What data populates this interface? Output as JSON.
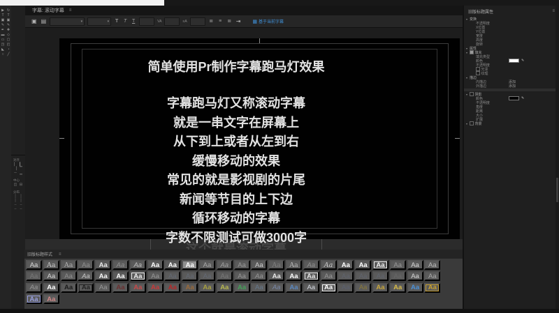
{
  "tab": {
    "title": "字幕: 滚动字幕",
    "menu": "≡"
  },
  "toolbar": {
    "new_title_glyph": "▣",
    "templates_glyph": "▤",
    "font_family_arrow": "▾",
    "font_style_arrow": "▾",
    "bold_glyph": "T",
    "italic_glyph": "T",
    "underline_glyph": "T",
    "kerning_glyph": "VA",
    "leading_glyph": "≡A",
    "align_left_glyph": "≣",
    "align_center_glyph": "≡",
    "align_right_glyph": "≣",
    "tab_stops_glyph": "⇥",
    "based_on_current": {
      "glyph": "▦",
      "label": "基于当前字幕"
    }
  },
  "tools": [
    {
      "n": "selection-tool",
      "g": "▶"
    },
    {
      "n": "rotation-tool",
      "g": "↻"
    },
    {
      "n": "type-tool",
      "g": "T"
    },
    {
      "n": "vertical-type-tool",
      "g": "T"
    },
    {
      "n": "area-type-tool",
      "g": "▣"
    },
    {
      "n": "vertical-area-type-tool",
      "g": "▣"
    },
    {
      "n": "path-type-tool",
      "g": "✎"
    },
    {
      "n": "vertical-path-type-tool",
      "g": "✎"
    },
    {
      "n": "pen-tool",
      "g": "✒"
    },
    {
      "n": "add-anchor-point-tool",
      "g": "✚"
    },
    {
      "n": "delete-anchor-point-tool",
      "g": "▬"
    },
    {
      "n": "convert-anchor-point-tool",
      "g": "◇"
    },
    {
      "n": "rectangle-tool",
      "g": "▭"
    },
    {
      "n": "rounded-rectangle-tool",
      "g": "▢"
    },
    {
      "n": "clipped-corner-rectangle-tool",
      "g": "◳"
    },
    {
      "n": "round-rectangle-tool",
      "g": "◰"
    },
    {
      "n": "wedge-tool",
      "g": "◣"
    },
    {
      "n": "arc-tool",
      "g": "◔"
    },
    {
      "n": "ellipse-tool",
      "g": "○"
    },
    {
      "n": "line-tool",
      "g": "╱"
    }
  ],
  "align_panel": {
    "sections": [
      {
        "label": "对齐",
        "buttons": [
          {
            "n": "align-horiz-left-button",
            "g": "▏"
          },
          {
            "n": "align-horiz-center-button",
            "g": "▎"
          },
          {
            "n": "align-horiz-right-button",
            "g": "▕"
          },
          {
            "n": "align-vert-top-button",
            "g": "▔"
          },
          {
            "n": "align-vert-center-button",
            "g": "─"
          },
          {
            "n": "align-vert-bottom-button",
            "g": "▁"
          }
        ]
      },
      {
        "label": "中心",
        "buttons": [
          {
            "n": "center-horizontal-button",
            "g": "◫"
          },
          {
            "n": "center-vertical-button",
            "g": "⊟"
          }
        ]
      },
      {
        "label": "分布",
        "buttons": [
          {
            "n": "distribute-left-button",
            "g": "┆"
          },
          {
            "n": "distribute-horiz-center-button",
            "g": "┆"
          },
          {
            "n": "distribute-right-button",
            "g": "┆"
          },
          {
            "n": "distribute-horiz-space-button",
            "g": "┆"
          },
          {
            "n": "distribute-top-button",
            "g": "┄"
          },
          {
            "n": "distribute-vert-center-button",
            "g": "┄"
          },
          {
            "n": "distribute-bottom-button",
            "g": "┄"
          },
          {
            "n": "distribute-vert-space-button",
            "g": "┄"
          }
        ]
      }
    ]
  },
  "canvas": {
    "title": "简单使用Pr制作字幕跑马灯效果",
    "lines": [
      "字幕跑马灯又称滚动字幕",
      "就是一串文字在屏幕上",
      "从下到上或者从左到右",
      "缓慢移动的效果",
      "常见的就是影视剧的片尾",
      "新闻等节目的上下边",
      "循环移动的字幕",
      "字数不限测试可做3000字"
    ],
    "faded_line": "这个就是滚动字幕"
  },
  "styles_panel": {
    "header": "旧版标题样式",
    "menu": "≡",
    "sample": "Aa",
    "rows": [
      [
        {
          "c": "#d8d8d8"
        },
        {
          "c": "#c8c8c8",
          "serif": 1
        },
        {
          "c": "#b0b0b0",
          "serif": 1
        },
        {
          "c": "#909090"
        },
        {
          "c": "#e8e8e8",
          "b": 1
        },
        {
          "c": "#909090",
          "i": 1
        },
        {
          "c": "#c0c0c0",
          "i": 1
        },
        {
          "c": "#ffffff",
          "b": 1
        },
        {
          "c": "#ffffff",
          "b": 1
        },
        {
          "c": "#ffffff",
          "b": 1,
          "bg": "#8f8f8f"
        },
        {
          "c": "#a8a8a8"
        },
        {
          "c": "#a0a0a0",
          "i": 1
        },
        {
          "c": "#989898"
        },
        {
          "c": "#d0d0d0"
        },
        {
          "c": "#808080",
          "serif": 1
        },
        {
          "c": "#b8b8b8",
          "serif": 1
        },
        {
          "c": "#909090",
          "i": 1
        },
        {
          "c": "#c8c8c8",
          "i": 1,
          "serif": 1
        },
        {
          "c": "#ffffff",
          "b": 1
        },
        {
          "c": "#ffffff",
          "b": 1
        },
        {
          "c": "#f0f0f0",
          "b": 1,
          "box": 1
        },
        {
          "c": "#989898"
        },
        {
          "c": "#d8d8d8"
        },
        {
          "c": "#b8b8b8"
        }
      ],
      [
        {
          "c": "#787878"
        },
        {
          "c": "#d8d8d8"
        },
        {
          "c": "#909090"
        },
        {
          "c": "#c8c8c8",
          "i": 1
        },
        {
          "c": "#f8f8f8",
          "b": 1
        },
        {
          "c": "#ffffff",
          "b": 1
        },
        {
          "c": "#f0f0f0",
          "b": 1,
          "box": 1
        },
        {
          "c": "#989898"
        },
        {
          "c": "#646a74"
        },
        {
          "c": "#646a74"
        },
        {
          "c": "#646a74"
        },
        {
          "c": "#787878"
        },
        {
          "c": "#989898"
        },
        {
          "c": "#989898",
          "i": 1
        },
        {
          "c": "#e8e8e8",
          "b": 1
        },
        {
          "c": "#ffffff",
          "b": 1
        },
        {
          "c": "#e8e8e8",
          "b": 1,
          "box": 1
        },
        {
          "c": "#989898"
        },
        {
          "c": "#60646e"
        },
        {
          "c": "#60646e"
        },
        {
          "c": "#60646e"
        },
        {
          "c": "#686868"
        },
        {
          "c": "#d8d8d8"
        },
        {
          "c": "#a8a8a8"
        }
      ],
      [
        {
          "c": "#989898",
          "i": 1
        },
        {
          "c": "#ffffff",
          "b": 1
        },
        {
          "c": "#1a1a1a",
          "b": 1
        },
        {
          "c": "#222222",
          "b": 1,
          "box": 1
        },
        {
          "c": "#989898"
        },
        {
          "c": "#6a3030",
          "b": 1
        },
        {
          "c": "#c84848",
          "b": 1
        },
        {
          "c": "#c83838",
          "b": 1
        },
        {
          "c": "#b82828",
          "b": 1
        },
        {
          "c": "#9a6a3a",
          "b": 1
        },
        {
          "c": "#a8a040",
          "b": 1
        },
        {
          "c": "#b8b850",
          "b": 1
        },
        {
          "c": "#44a058",
          "b": 1
        },
        {
          "c": "#66788c"
        },
        {
          "c": "#7888a8",
          "i": 1
        },
        {
          "c": "#5a88c0",
          "b": 1
        },
        {
          "c": "#d8dce4"
        },
        {
          "c": "#ffffff",
          "b": 1,
          "box": 1
        },
        {
          "c": "#5a6070"
        },
        {
          "c": "#8a7838"
        },
        {
          "c": "#caa83c",
          "b": 1
        },
        {
          "c": "#d8bc48",
          "b": 1
        },
        {
          "c": "#4a90d8",
          "b": 1
        },
        {
          "c": "#c8a030",
          "b": 1,
          "box": 1
        }
      ],
      [
        {
          "c": "#98a0e0",
          "b": 1,
          "box": 1
        },
        {
          "c": "#d08888",
          "b": 1
        }
      ]
    ]
  },
  "properties_panel": {
    "header": "旧版标题属性",
    "menu": "≡",
    "rows": [
      {
        "t": "group",
        "label": "变换"
      },
      {
        "label": "不透明度"
      },
      {
        "label": "X位置"
      },
      {
        "label": "Y位置"
      },
      {
        "label": "宽度"
      },
      {
        "label": "高度"
      },
      {
        "label": "旋转"
      },
      {
        "t": "group",
        "label": "属性"
      },
      {
        "t": "group",
        "label": "填充",
        "check": 2
      },
      {
        "label": "填充类型"
      },
      {
        "label": "颜色",
        "swatch": "#ffffff",
        "dropper": "✎"
      },
      {
        "label": "不透明度"
      },
      {
        "label": "光泽",
        "check": 1
      },
      {
        "label": "纹理",
        "check": 1
      },
      {
        "t": "group",
        "label": "描边"
      },
      {
        "label": "内描边",
        "value": "添加"
      },
      {
        "label": "外描边",
        "value": "添加"
      },
      {
        "t": "divider"
      },
      {
        "t": "group",
        "label": "阴影",
        "check": 1
      },
      {
        "label": "颜色",
        "swatch": "#000000",
        "dropper": "✎"
      },
      {
        "label": "不透明度"
      },
      {
        "label": "角度"
      },
      {
        "label": "距离"
      },
      {
        "label": "大小"
      },
      {
        "label": "扩展"
      },
      {
        "t": "group",
        "label": "背景",
        "check": 1
      }
    ]
  }
}
